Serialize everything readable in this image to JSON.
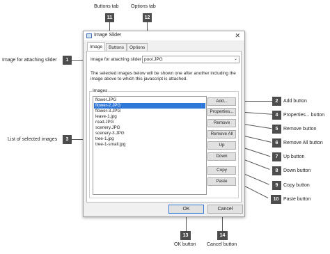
{
  "dialog": {
    "title": "Image Slider",
    "tabs": [
      {
        "label": "Image"
      },
      {
        "label": "Buttons"
      },
      {
        "label": "Options"
      }
    ],
    "image_field_label": "Image for attaching slider",
    "image_field_value": "pool.JPG",
    "description": "The selected images below will be shown one after another including the image above to which this javascript is attached.",
    "images_group_title": "Images",
    "images": [
      {
        "name": "flower.JPG",
        "selected": false
      },
      {
        "name": "flower-2.JPG",
        "selected": true
      },
      {
        "name": "flower-3.JPG",
        "selected": false
      },
      {
        "name": "leave-1.jpg",
        "selected": false
      },
      {
        "name": "road.JPG",
        "selected": false
      },
      {
        "name": "scenery.JPG",
        "selected": false
      },
      {
        "name": "scenery-3.JPG",
        "selected": false
      },
      {
        "name": "tree-1.jpg",
        "selected": false
      },
      {
        "name": "tree-1-small.jpg",
        "selected": false
      }
    ],
    "side_buttons": {
      "add": "Add...",
      "properties": "Properties...",
      "remove": "Remove",
      "remove_all": "Remove All",
      "up": "Up",
      "down": "Down",
      "copy": "Copy",
      "paste": "Paste"
    },
    "ok_label": "OK",
    "cancel_label": "Cancel"
  },
  "callouts": {
    "c1": {
      "number": "1",
      "text": "Image for attaching slider"
    },
    "c2": {
      "number": "2",
      "text": "Add button"
    },
    "c3": {
      "number": "3",
      "text": "List of selected images"
    },
    "c4": {
      "number": "4",
      "text": "Properties... button"
    },
    "c5": {
      "number": "5",
      "text": "Remove button"
    },
    "c6": {
      "number": "6",
      "text": "Remove All button"
    },
    "c7": {
      "number": "7",
      "text": "Up button"
    },
    "c8": {
      "number": "8",
      "text": "Down button"
    },
    "c9": {
      "number": "9",
      "text": "Copy button"
    },
    "c10": {
      "number": "10",
      "text": "Paste button"
    },
    "c11": {
      "number": "11",
      "text": "Buttons tab"
    },
    "c12": {
      "number": "12",
      "text": "Options tab"
    },
    "c13": {
      "number": "13",
      "text": "OK button"
    },
    "c14": {
      "number": "14",
      "text": "Cancel button"
    }
  },
  "colors": {
    "selection": "#3078d8",
    "callout_badge": "#4d4d4d",
    "dialog_bg": "#f0f0f0"
  }
}
